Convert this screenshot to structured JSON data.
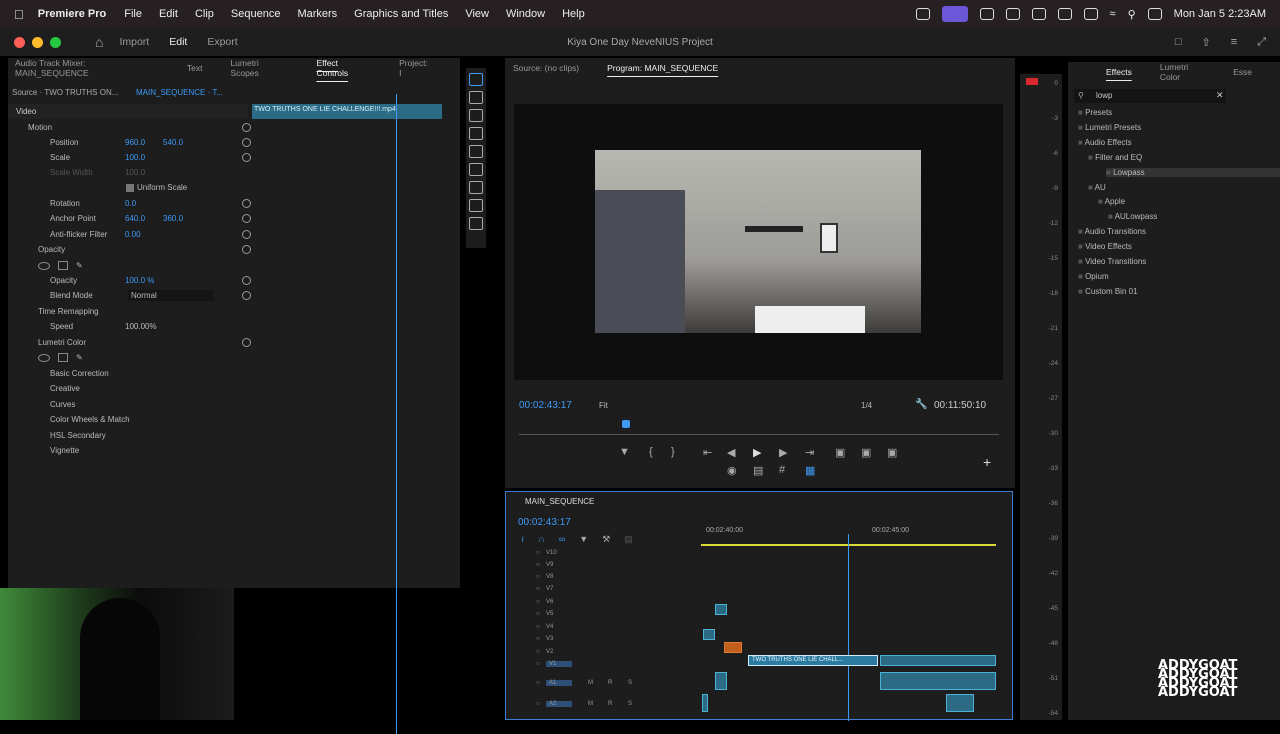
{
  "menubar": {
    "app": "Premiere Pro",
    "items": [
      "File",
      "Edit",
      "Clip",
      "Sequence",
      "Markers",
      "Graphics and Titles",
      "View",
      "Window",
      "Help"
    ],
    "clock": "Mon Jan 5  2:23AM"
  },
  "titlebar": {
    "workspaces": [
      "Import",
      "Edit",
      "Export"
    ],
    "title": "Kiya One Day NeveNIUS Project"
  },
  "left": {
    "tabs": [
      "Audio Track Mixer: MAIN_SEQUENCE",
      "Text",
      "Lumetri Scopes",
      "Effect Controls",
      "Project: I"
    ],
    "source": "Source · TWO TRUTHS ON...",
    "seq": "MAIN_SEQUENCE · T...",
    "clipname": "TWO TRUTHS ONE LIE CHALLENGE!!!.mp4",
    "video": "Video",
    "motion": "Motion",
    "position": "Position",
    "pos_x": "960.0",
    "pos_y": "540.0",
    "scale": "Scale",
    "scale_v": "100.0",
    "scale_width": "Scale Width",
    "scale_width_v": "100.0",
    "uniform": "Uniform Scale",
    "rotation": "Rotation",
    "rotation_v": "0.0",
    "anchor": "Anchor Point",
    "anchor_x": "640.0",
    "anchor_y": "360.0",
    "antiflicker": "Anti-flicker Filter",
    "antiflicker_v": "0.00",
    "opacity_fx": "Opacity",
    "opacity": "Opacity",
    "opacity_v": "100.0 %",
    "blend": "Blend Mode",
    "blend_v": "Normal",
    "timeremap": "Time Remapping",
    "speed": "Speed",
    "speed_v": "100.00%",
    "lumetri": "Lumetri Color",
    "lumetri_items": [
      "Basic Correction",
      "Creative",
      "Curves",
      "Color Wheels & Match",
      "HSL Secondary",
      "Vignette"
    ]
  },
  "program": {
    "source_tab": "Source: (no clips)",
    "program_tab": "Program: MAIN_SEQUENCE",
    "timecode": "00:02:43:17",
    "fit": "Fit",
    "res": "1/4",
    "duration": "00:11:50:10"
  },
  "timeline": {
    "name": "MAIN_SEQUENCE",
    "timecode": "00:02:43:17",
    "ruler": [
      "00:02:40:00",
      "00:02:45:00"
    ],
    "vtracks": [
      "V10",
      "V9",
      "V8",
      "V7",
      "V6",
      "V5",
      "V4",
      "V3",
      "V2",
      "V1"
    ],
    "atracks": [
      "A1",
      "A2"
    ],
    "msr": [
      "M",
      "R",
      "S"
    ],
    "clip_label": "TWO TRUTHS ONE LIE CHALL..."
  },
  "meter": {
    "db": [
      "0",
      "-3",
      "-6",
      "-9",
      "-12",
      "-15",
      "-18",
      "-21",
      "-24",
      "-27",
      "-30",
      "-33",
      "-36",
      "-39",
      "-42",
      "-45",
      "-48",
      "-51",
      "-54"
    ]
  },
  "effects": {
    "tabs": [
      "Effects",
      "Lumetri Color",
      "Esse"
    ],
    "search": "lowp",
    "tree": [
      {
        "label": "Presets",
        "depth": 0
      },
      {
        "label": "Lumetri Presets",
        "depth": 0
      },
      {
        "label": "Audio Effects",
        "depth": 0
      },
      {
        "label": "Filter and EQ",
        "depth": 1
      },
      {
        "label": "Lowpass",
        "depth": 2
      },
      {
        "label": "AU",
        "depth": 1
      },
      {
        "label": "Apple",
        "depth": 2
      },
      {
        "label": "AULowpass",
        "depth": 3
      },
      {
        "label": "Audio Transitions",
        "depth": 0
      },
      {
        "label": "Video Effects",
        "depth": 0
      },
      {
        "label": "Video Transitions",
        "depth": 0
      },
      {
        "label": "Opium",
        "depth": 0
      },
      {
        "label": "Custom Bin 01",
        "depth": 0
      }
    ]
  },
  "watermark": [
    "ADDYGOAT",
    "ADDYGOAT",
    "ADDYGOAT",
    "ADDYGOAT"
  ]
}
